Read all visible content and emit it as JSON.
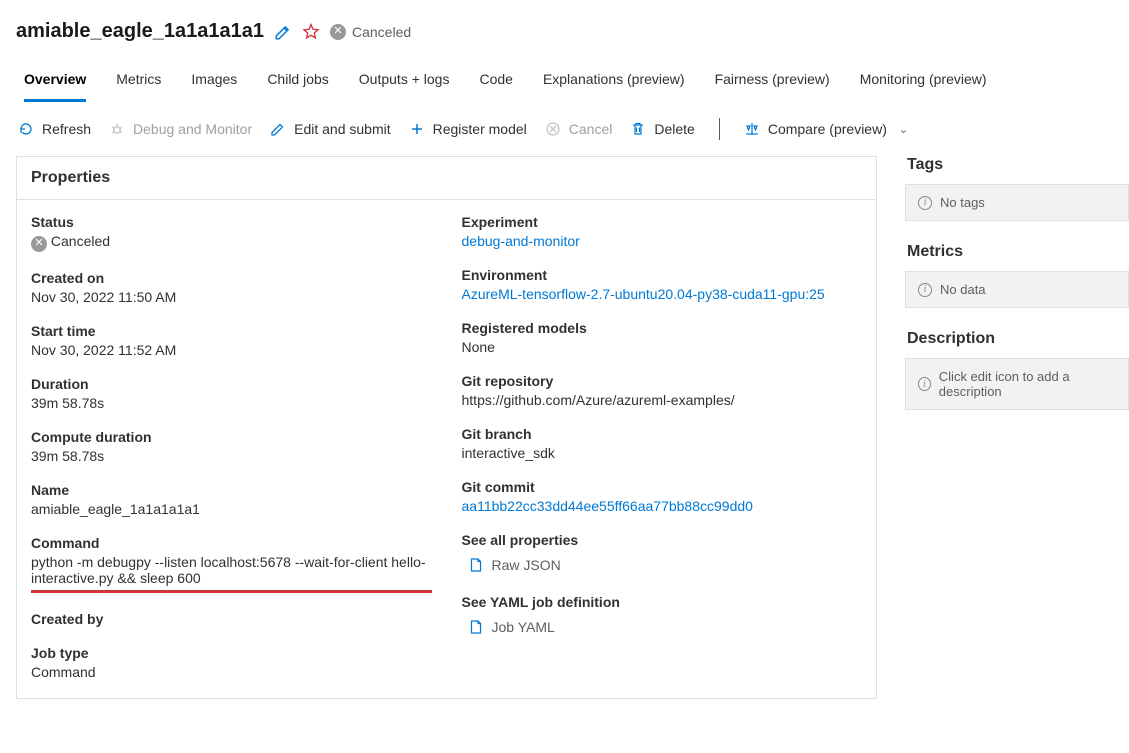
{
  "header": {
    "title": "amiable_eagle_1a1a1a1a1",
    "status": "Canceled"
  },
  "tabs": [
    "Overview",
    "Metrics",
    "Images",
    "Child jobs",
    "Outputs + logs",
    "Code",
    "Explanations (preview)",
    "Fairness (preview)",
    "Monitoring (preview)"
  ],
  "active_tab": 0,
  "cmdbar": {
    "refresh": "Refresh",
    "debug": "Debug and Monitor",
    "edit": "Edit and submit",
    "register": "Register model",
    "cancel": "Cancel",
    "delete": "Delete",
    "compare": "Compare (preview)"
  },
  "properties_title": "Properties",
  "props_left": {
    "status_k": "Status",
    "status_v": "Canceled",
    "created_k": "Created on",
    "created_v": "Nov 30, 2022 11:50 AM",
    "start_k": "Start time",
    "start_v": "Nov 30, 2022 11:52 AM",
    "dur_k": "Duration",
    "dur_v": "39m 58.78s",
    "cdur_k": "Compute duration",
    "cdur_v": "39m 58.78s",
    "name_k": "Name",
    "name_v": "amiable_eagle_1a1a1a1a1",
    "cmd_k": "Command",
    "cmd_v": "python -m debugpy --listen localhost:5678 --wait-for-client hello-interactive.py && sleep 600",
    "createdby_k": "Created by",
    "createdby_v": "",
    "jobtype_k": "Job type",
    "jobtype_v": "Command"
  },
  "props_right": {
    "exp_k": "Experiment",
    "exp_v": "debug-and-monitor",
    "env_k": "Environment",
    "env_v": "AzureML-tensorflow-2.7-ubuntu20.04-py38-cuda11-gpu:25",
    "regm_k": "Registered models",
    "regm_v": "None",
    "gitrepo_k": "Git repository",
    "gitrepo_v": "https://github.com/Azure/azureml-examples/",
    "gitbranch_k": "Git branch",
    "gitbranch_v": "interactive_sdk",
    "gitcommit_k": "Git commit",
    "gitcommit_v": "aa11bb22cc33dd44ee55ff66aa77bb88cc99dd0",
    "seeall_k": "See all properties",
    "rawjson": "Raw JSON",
    "seeyaml_k": "See YAML job definition",
    "jobyaml": "Job YAML"
  },
  "side": {
    "tags_title": "Tags",
    "tags_empty": "No tags",
    "metrics_title": "Metrics",
    "metrics_empty": "No data",
    "desc_title": "Description",
    "desc_empty": "Click edit icon to add a description"
  }
}
